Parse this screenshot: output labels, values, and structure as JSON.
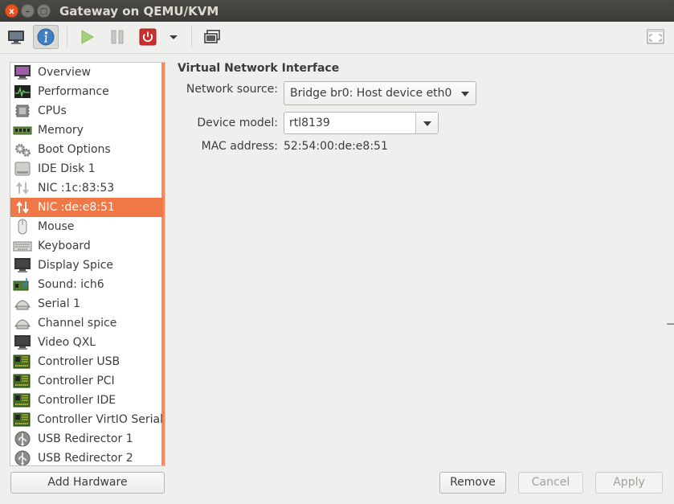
{
  "window": {
    "title": "Gateway on QEMU/KVM",
    "close_glyph": "x",
    "minimize_glyph": "–",
    "maximize_glyph": "□"
  },
  "toolbar": {
    "buttons": [
      {
        "name": "console-icon"
      },
      {
        "name": "info-icon"
      },
      {
        "name": "run-icon"
      },
      {
        "name": "pause-icon"
      },
      {
        "name": "power-icon"
      },
      {
        "name": "power-menu-chevron-icon"
      },
      {
        "name": "snapshots-icon"
      },
      {
        "name": "fullscreen-icon"
      }
    ]
  },
  "sidebar": {
    "items": [
      {
        "label": "Overview",
        "icon": "monitor-purple-icon"
      },
      {
        "label": "Performance",
        "icon": "performance-graph-icon"
      },
      {
        "label": "CPUs",
        "icon": "cpu-icon"
      },
      {
        "label": "Memory",
        "icon": "memory-icon"
      },
      {
        "label": "Boot Options",
        "icon": "gears-icon"
      },
      {
        "label": "IDE Disk 1",
        "icon": "disk-icon"
      },
      {
        "label": "NIC :1c:83:53",
        "icon": "network-arrows-icon"
      },
      {
        "label": "NIC :de:e8:51",
        "icon": "network-arrows-icon",
        "selected": true
      },
      {
        "label": "Mouse",
        "icon": "mouse-icon"
      },
      {
        "label": "Keyboard",
        "icon": "keyboard-icon"
      },
      {
        "label": "Display Spice",
        "icon": "display-icon"
      },
      {
        "label": "Sound: ich6",
        "icon": "sound-card-icon"
      },
      {
        "label": "Serial 1",
        "icon": "serial-icon"
      },
      {
        "label": "Channel spice",
        "icon": "channel-icon"
      },
      {
        "label": "Video QXL",
        "icon": "video-icon"
      },
      {
        "label": "Controller USB",
        "icon": "controller-card-icon"
      },
      {
        "label": "Controller PCI",
        "icon": "controller-card-icon"
      },
      {
        "label": "Controller IDE",
        "icon": "controller-card-icon"
      },
      {
        "label": "Controller VirtIO Serial",
        "icon": "controller-card-icon"
      },
      {
        "label": "USB Redirector 1",
        "icon": "usb-icon"
      },
      {
        "label": "USB Redirector 2",
        "icon": "usb-icon"
      }
    ],
    "add_hardware_label": "Add Hardware"
  },
  "details": {
    "section_title": "Virtual Network Interface",
    "network_source_label": "Network source:",
    "network_source_value": "Bridge br0: Host device eth0",
    "device_model_label": "Device model:",
    "device_model_value": "rtl8139",
    "mac_address_label": "MAC address:",
    "mac_address_value": "52:54:00:de:e8:51"
  },
  "footer": {
    "remove_label": "Remove",
    "cancel_label": "Cancel",
    "apply_label": "Apply"
  },
  "colors": {
    "accent": "#f07746",
    "titlebar": "#3c3b37",
    "close_button": "#e95420"
  }
}
